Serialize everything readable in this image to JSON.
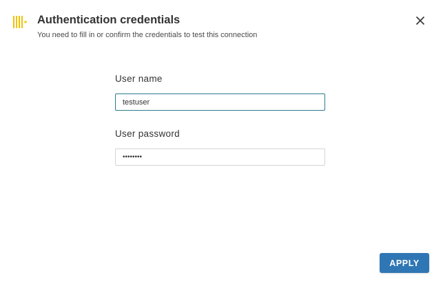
{
  "header": {
    "title": "Authentication credentials",
    "subtitle": "You need to fill in or confirm the credentials to test this connection",
    "logo_icon": "yellow-bars-logo-icon",
    "close_icon": "close-icon"
  },
  "form": {
    "username": {
      "label": "User name",
      "value": "testuser"
    },
    "password": {
      "label": "User password",
      "value": "••••••••"
    }
  },
  "footer": {
    "apply_label": "APPLY"
  },
  "colors": {
    "accent": "#2f77b4",
    "focus_border": "#2a7a8c",
    "logo": "#f2c200"
  }
}
